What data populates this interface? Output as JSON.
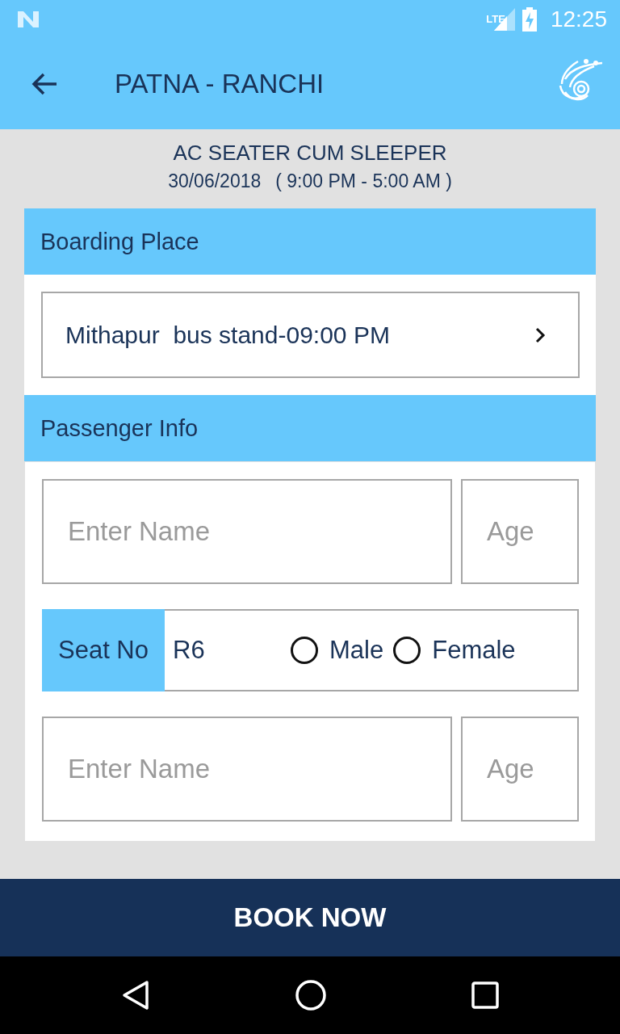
{
  "status_bar": {
    "time": "12:25",
    "network": "LTE"
  },
  "app_bar": {
    "title": "PATNA - RANCHI"
  },
  "trip": {
    "bus_type": "AC SEATER CUM SLEEPER",
    "date": "30/06/2018",
    "time_range": "( 9:00 PM - 5:00 AM )"
  },
  "boarding": {
    "header": "Boarding Place",
    "selection": "Mithapur  bus stand-09:00 PM"
  },
  "passenger_info": {
    "header": "Passenger Info",
    "passengers": [
      {
        "name_placeholder": "Enter Name",
        "age_placeholder": "Age",
        "seat_label": "Seat No",
        "seat": "R6",
        "genders": [
          {
            "label": "Male",
            "selected": false
          },
          {
            "label": "Female",
            "selected": false
          }
        ]
      },
      {
        "name_placeholder": "Enter Name",
        "age_placeholder": "Age"
      }
    ]
  },
  "book_button": "BOOK NOW"
}
